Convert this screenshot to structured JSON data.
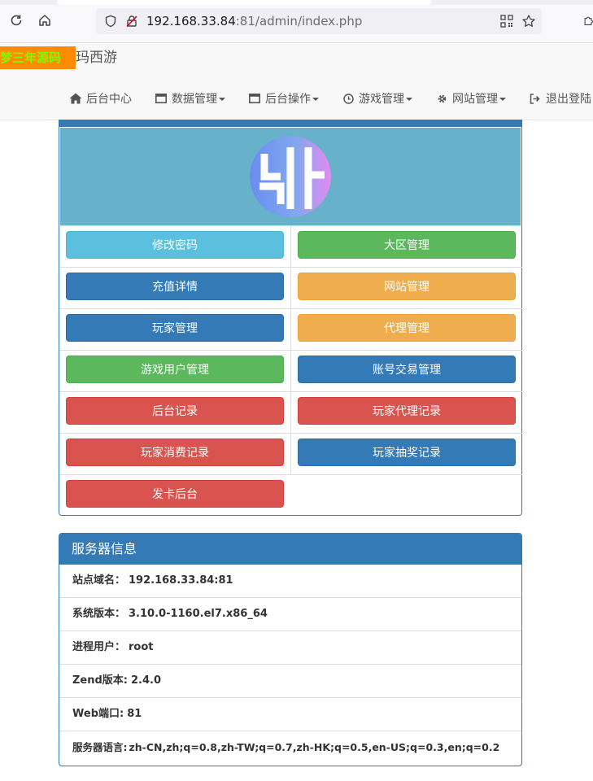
{
  "browser": {
    "url_host": "192.168.33.84",
    "url_rest": ":81/admin/index.php"
  },
  "navbar": {
    "brand_badge": "梦三年源码",
    "brand_rest": "玛西游",
    "menu": [
      {
        "label": "后台中心",
        "icon": "home-icon",
        "dropdown": false
      },
      {
        "label": "数据管理",
        "icon": "window-icon",
        "dropdown": true
      },
      {
        "label": "后台操作",
        "icon": "window-icon",
        "dropdown": true
      },
      {
        "label": "游戏管理",
        "icon": "clock-icon",
        "dropdown": true
      },
      {
        "label": "网站管理",
        "icon": "gear-icon",
        "dropdown": true
      },
      {
        "label": "退出登陆",
        "icon": "logout-icon",
        "dropdown": false
      }
    ]
  },
  "buttons": [
    {
      "label": "修改密码",
      "style": "info"
    },
    {
      "label": "大区管理",
      "style": "success"
    },
    {
      "label": "充值详情",
      "style": "primary"
    },
    {
      "label": "网站管理",
      "style": "warning"
    },
    {
      "label": "玩家管理",
      "style": "primary"
    },
    {
      "label": "代理管理",
      "style": "warning"
    },
    {
      "label": "游戏用户管理",
      "style": "success"
    },
    {
      "label": "账号交易管理",
      "style": "primary"
    },
    {
      "label": "后台记录",
      "style": "danger"
    },
    {
      "label": "玩家代理记录",
      "style": "danger"
    },
    {
      "label": "玩家消费记录",
      "style": "danger"
    },
    {
      "label": "玩家抽奖记录",
      "style": "primary"
    },
    {
      "label": "发卡后台",
      "style": "danger"
    }
  ],
  "server_info": {
    "title": "服务器信息",
    "rows": [
      {
        "label": "站点域名：",
        "value": "192.168.33.84:81"
      },
      {
        "label": "系统版本：",
        "value": "3.10.0-1160.el7.x86_64"
      },
      {
        "label": "进程用户：",
        "value": "root"
      },
      {
        "label": "Zend版本:",
        "value": "2.4.0"
      },
      {
        "label": "Web端口:",
        "value": "81"
      },
      {
        "label": "服务器语言:",
        "value": "zh-CN,zh;q=0.8,zh-TW;q=0.7,zh-HK;q=0.5,en-US;q=0.3,en;q=0.2"
      }
    ]
  },
  "colors": {
    "primary": "#337ab7",
    "info": "#5bc0de",
    "success": "#5cb85c",
    "warning": "#f0ad4e",
    "danger": "#d9534f",
    "hero_bg": "#67b1cb",
    "brand_badge_bg": "#ff8c00",
    "brand_badge_text": "#7cfc00"
  }
}
